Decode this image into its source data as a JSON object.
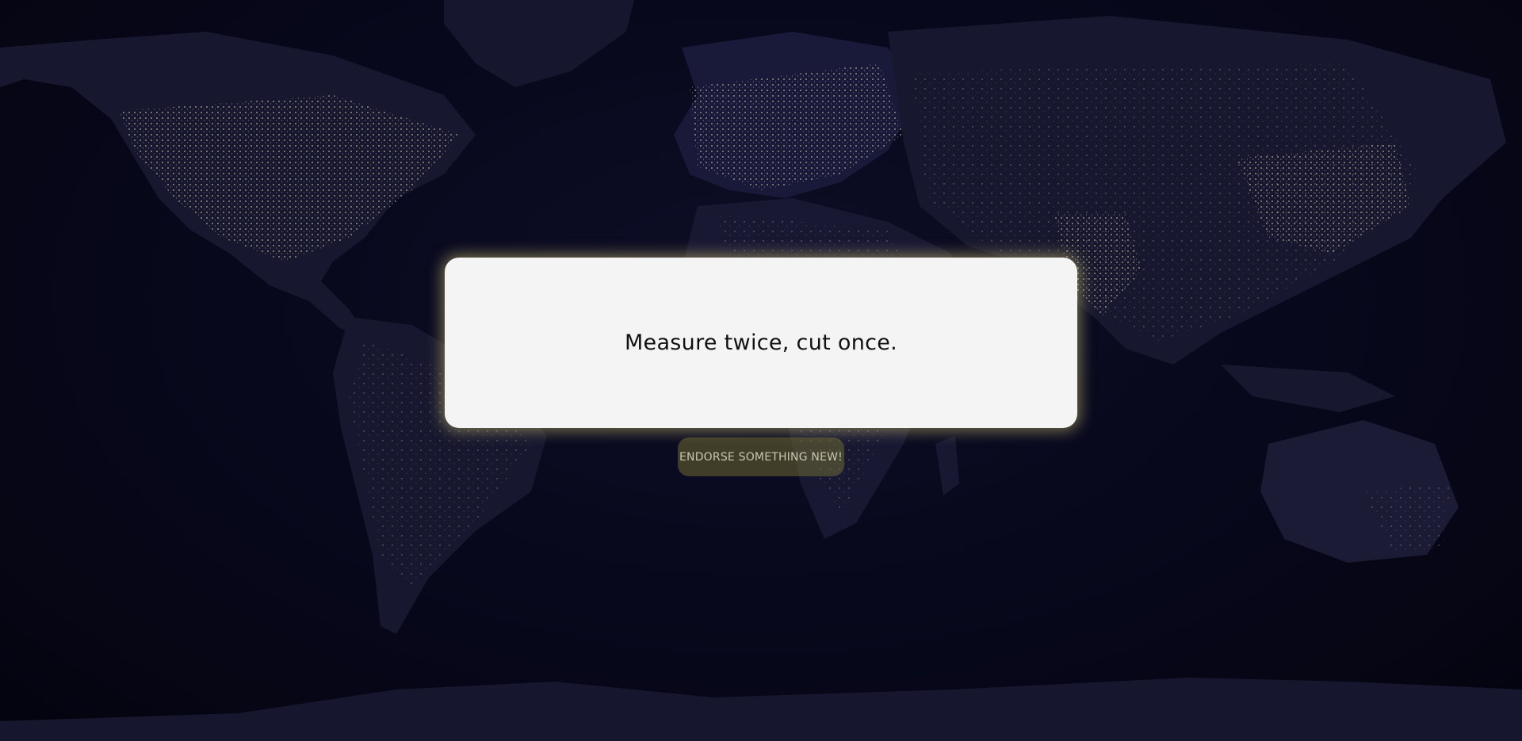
{
  "background": {
    "image": "world-at-night-map",
    "base_color": "#07071a",
    "city_light_color": "#e8e4b8",
    "land_color": "#1a1a33"
  },
  "quote": {
    "text": "Measure twice, cut once."
  },
  "endorse_button": {
    "label": "ENDORSE SOMETHING NEW!"
  },
  "colors": {
    "card_background": "#f4f4f4",
    "card_glow": "#c8be6e",
    "button_background": "#6e6932"
  }
}
